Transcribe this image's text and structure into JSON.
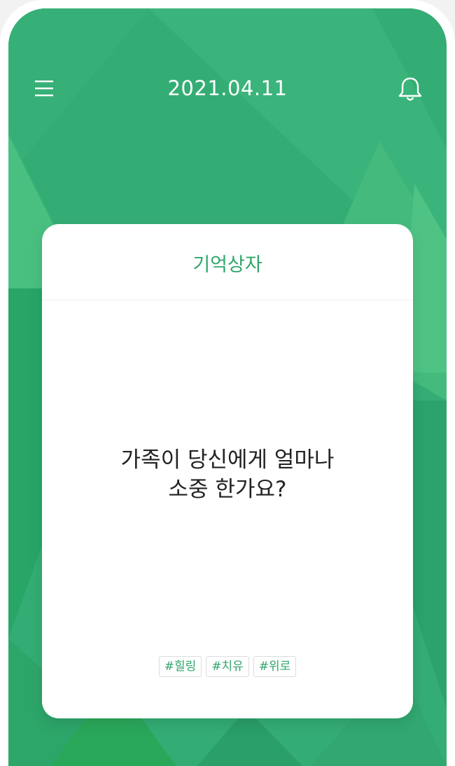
{
  "header": {
    "date": "2021.04.11",
    "menu_icon": "hamburger-menu-icon",
    "notification_icon": "bell-icon"
  },
  "card": {
    "title": "기억상자",
    "question_lines": [
      "가족이 당신에게 얼마나",
      "소중 한가요?"
    ],
    "tags": [
      "#힐링",
      "#치유",
      "#위로"
    ]
  },
  "colors": {
    "background_green": "#34ad74",
    "accent_green": "#2fa66a",
    "card_background": "#ffffff",
    "question_text": "#222222"
  }
}
